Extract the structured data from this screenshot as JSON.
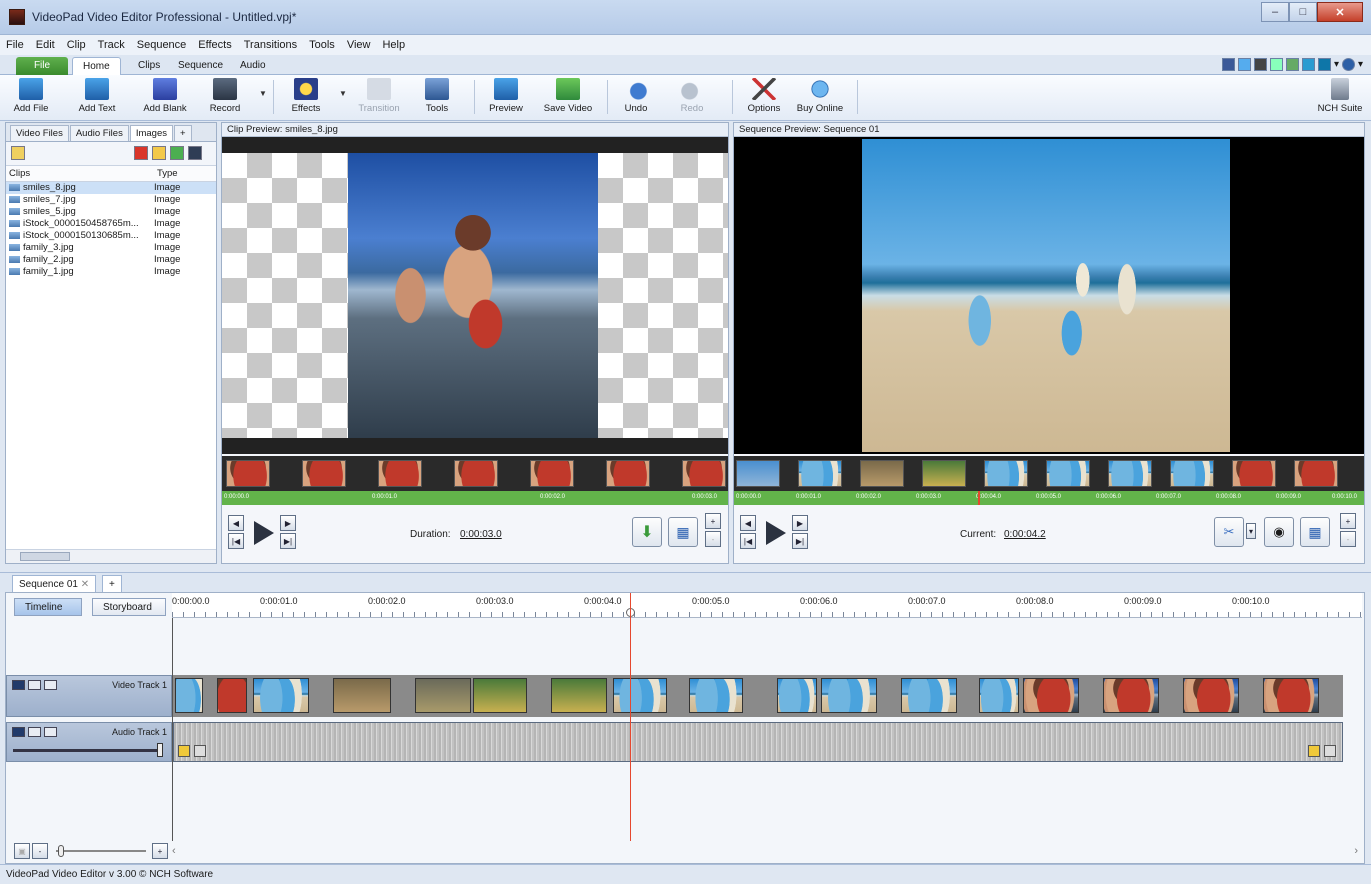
{
  "window": {
    "title": "VideoPad Video Editor Professional - Untitled.vpj*"
  },
  "menu": [
    "File",
    "Edit",
    "Clip",
    "Track",
    "Sequence",
    "Effects",
    "Transitions",
    "Tools",
    "View",
    "Help"
  ],
  "ribbon_tabs": [
    "File",
    "Home",
    "Clips",
    "Sequence",
    "Audio"
  ],
  "toolbar": {
    "add_file": "Add File",
    "add_text": "Add Text",
    "add_blank": "Add Blank",
    "record": "Record",
    "effects": "Effects",
    "transition": "Transition",
    "tools": "Tools",
    "preview": "Preview",
    "save_video": "Save Video",
    "undo": "Undo",
    "redo": "Redo",
    "options": "Options",
    "buy_online": "Buy Online",
    "nch_suite": "NCH Suite"
  },
  "bin": {
    "tabs": [
      "Video Files",
      "Audio Files",
      "Images",
      "+"
    ],
    "col_clips": "Clips",
    "col_type": "Type",
    "clips": [
      {
        "name": "smiles_8.jpg",
        "type": "Image"
      },
      {
        "name": "smiles_7.jpg",
        "type": "Image"
      },
      {
        "name": "smiles_5.jpg",
        "type": "Image"
      },
      {
        "name": "iStock_0000150458765m...",
        "type": "Image"
      },
      {
        "name": "iStock_0000150130685m...",
        "type": "Image"
      },
      {
        "name": "family_3.jpg",
        "type": "Image"
      },
      {
        "name": "family_2.jpg",
        "type": "Image"
      },
      {
        "name": "family_1.jpg",
        "type": "Image"
      }
    ]
  },
  "clip_preview": {
    "header": "Clip Preview: smiles_8.jpg",
    "ruler": [
      "0:00:00.0",
      "0:00:01.0",
      "0:00:02.0",
      "0:00:03.0"
    ],
    "duration_label": "Duration:",
    "duration": "0:00:03.0"
  },
  "sequence_preview": {
    "header": "Sequence Preview: Sequence 01",
    "ruler": [
      "0:00:00.0",
      "0:00:01.0",
      "0:00:02.0",
      "0:00:03.0",
      "0:00:04.0",
      "0:00:05.0",
      "0:00:06.0",
      "0:00:07.0",
      "0:00:08.0",
      "0:00:09.0",
      "0:00:10.0"
    ],
    "current_label": "Current:",
    "current": "0:00:04.2"
  },
  "timeline": {
    "seq_tab": "Sequence 01",
    "timeline_btn": "Timeline",
    "storyboard_btn": "Storyboard",
    "ruler": [
      "0:00:00.0",
      "0:00:01.0",
      "0:00:02.0",
      "0:00:03.0",
      "0:00:04.0",
      "0:00:05.0",
      "0:00:06.0",
      "0:00:07.0",
      "0:00:08.0",
      "0:00:09.0",
      "0:00:10.0"
    ],
    "video_track": "Video Track 1",
    "audio_track": "Audio Track 1"
  },
  "status": "VideoPad Video Editor v 3.00 © NCH Software"
}
